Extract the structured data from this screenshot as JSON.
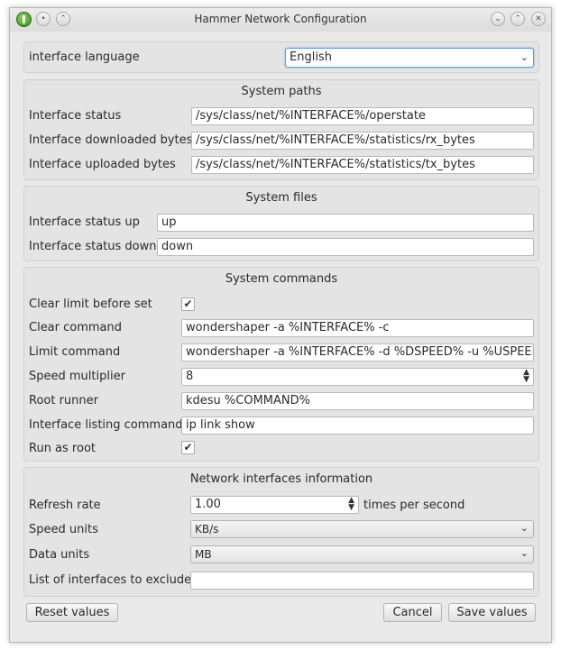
{
  "window": {
    "title": "Hammer Network Configuration"
  },
  "language": {
    "label": "interface language",
    "value": "English"
  },
  "system_paths": {
    "title": "System paths",
    "status_label": "Interface status",
    "status_value": "/sys/class/net/%INTERFACE%/operstate",
    "down_label": "Interface downloaded bytes",
    "down_value": "/sys/class/net/%INTERFACE%/statistics/rx_bytes",
    "up_label": "Interface uploaded bytes",
    "up_value": "/sys/class/net/%INTERFACE%/statistics/tx_bytes"
  },
  "system_files": {
    "title": "System files",
    "status_up_label": "Interface status up",
    "status_up_value": "up",
    "status_down_label": "Interface status down",
    "status_down_value": "down"
  },
  "system_commands": {
    "title": "System commands",
    "clear_limit_label": "Clear limit before set",
    "clear_limit_checked": true,
    "clear_command_label": "Clear command",
    "clear_command_value": "wondershaper -a %INTERFACE% -c",
    "limit_command_label": "Limit command",
    "limit_command_value": "wondershaper -a %INTERFACE% -d %DSPEED% -u %USPEED%",
    "speed_multiplier_label": "Speed multiplier",
    "speed_multiplier_value": "8",
    "root_runner_label": "Root runner",
    "root_runner_value": "kdesu %COMMAND%",
    "listing_label": "Interface listing command",
    "listing_value": "ip link show",
    "run_as_root_label": "Run as root",
    "run_as_root_checked": true
  },
  "network_info": {
    "title": "Network interfaces information",
    "refresh_label": "Refresh rate",
    "refresh_value": "1.00",
    "refresh_suffix": "times per second",
    "speed_units_label": "Speed units",
    "speed_units_value": "KB/s",
    "data_units_label": "Data units",
    "data_units_value": "MB",
    "exclude_label": "List of interfaces to exclude",
    "exclude_value": ""
  },
  "buttons": {
    "reset": "Reset values",
    "cancel": "Cancel",
    "save": "Save values"
  },
  "icons": {
    "check": "✔"
  }
}
